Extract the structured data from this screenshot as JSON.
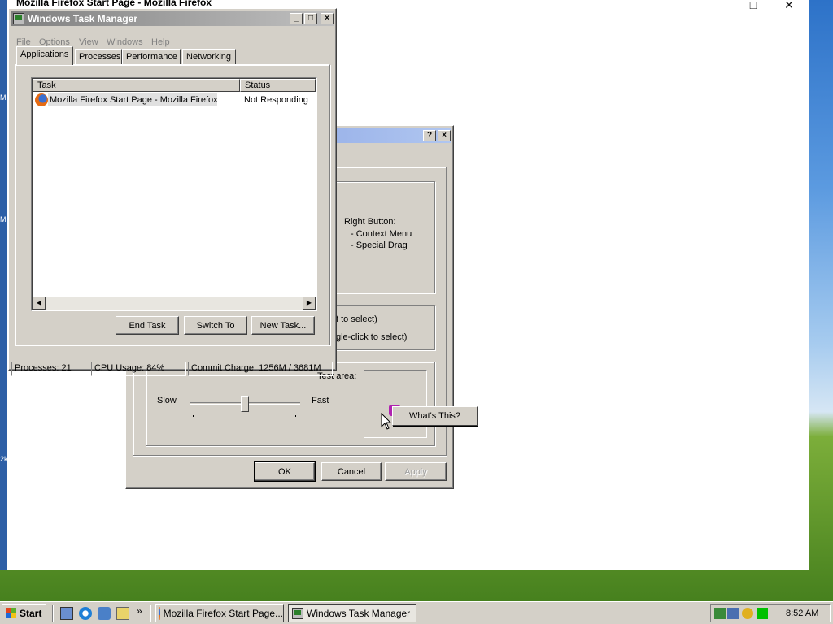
{
  "firefox_window": {
    "title": "Mozilla Firefox Start Page - Mozilla Firefox",
    "left_strip_labels": [
      "M",
      "M",
      "2k"
    ]
  },
  "task_manager": {
    "title": "Windows Task Manager",
    "menu": [
      "File",
      "Options",
      "View",
      "Windows",
      "Help"
    ],
    "tabs": [
      "Applications",
      "Processes",
      "Performance",
      "Networking"
    ],
    "columns": [
      "Task",
      "Status"
    ],
    "rows": [
      {
        "task": "Mozilla Firefox Start Page - Mozilla Firefox",
        "status": "Not Responding"
      }
    ],
    "buttons": {
      "end_task": "End Task",
      "switch_to": "Switch To",
      "new_task": "New Task..."
    },
    "status_bar": {
      "processes": "Processes: 21",
      "cpu": "CPU Usage: 84%",
      "commit": "Commit Charge: 1256M / 3681M"
    }
  },
  "mouse_dialog": {
    "right_button_heading": "Right Button:",
    "right_button_items": [
      "-  Context Menu",
      "-  Special Drag"
    ],
    "partial_text_1": "t to select)",
    "partial_text_2": "gle-click to select)",
    "test_area_label": "Test area:",
    "slow_label": "Slow",
    "fast_label": "Fast",
    "speed_level": 0.5,
    "buttons": {
      "ok": "OK",
      "cancel": "Cancel",
      "apply": "Apply"
    }
  },
  "context_menu": {
    "item": "What's This?"
  },
  "taskbar": {
    "start_label": "Start",
    "overflow": "»",
    "tasks": [
      "Mozilla Firefox Start Page...",
      "Windows Task Manager"
    ],
    "clock": "8:52 AM"
  },
  "colors": {
    "face": "#d4d0c8",
    "accent": "#0a246a",
    "selection": "#e8e6e0"
  }
}
